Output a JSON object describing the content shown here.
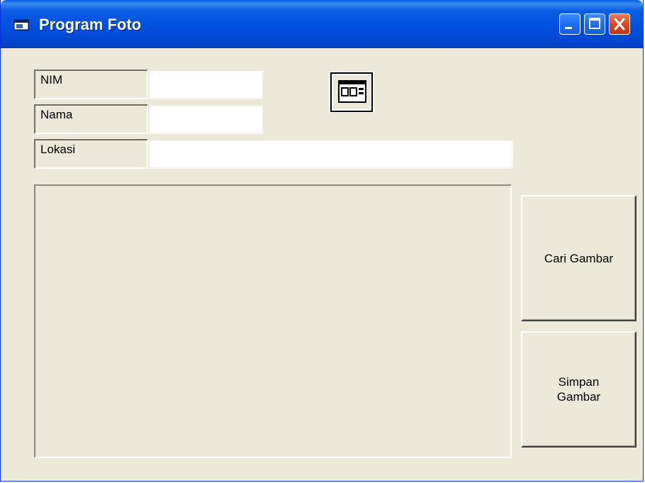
{
  "window": {
    "title": "Program Foto",
    "controls": [
      "minimize",
      "maximize",
      "close"
    ]
  },
  "form": {
    "nim_label": "NIM",
    "nim_value": "",
    "nama_label": "Nama",
    "nama_value": "",
    "lokasi_label": "Lokasi",
    "lokasi_value": ""
  },
  "icons": {
    "app_icon": "form-icon",
    "common_dialog": "common-dialog-control-icon"
  },
  "buttons": {
    "cari": "Cari Gambar",
    "simpan": "Simpan\nGambar"
  },
  "colors": {
    "titlebar": "#0054e3",
    "face": "#ece9d8",
    "close": "#d4481f"
  }
}
